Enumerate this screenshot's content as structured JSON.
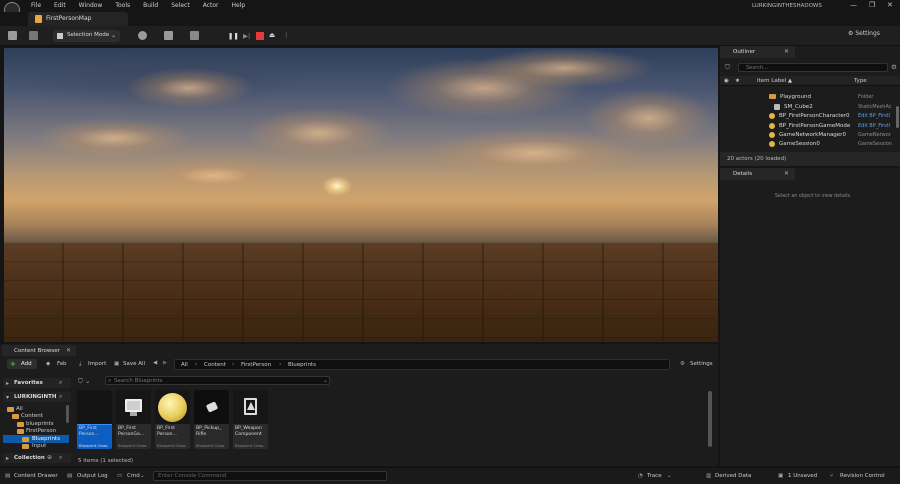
{
  "menubar": {
    "items": [
      "File",
      "Edit",
      "Window",
      "Tools",
      "Build",
      "Select",
      "Actor",
      "Help"
    ],
    "project": "LURKINGINTHESHADOWS",
    "window_controls": [
      "minimize-icon",
      "restore-icon",
      "close-icon"
    ]
  },
  "tab": {
    "title": "FirstPersonMap"
  },
  "toolbar": {
    "selection_mode": "Selection Mode",
    "settings": "Settings"
  },
  "outliner": {
    "tab": "Outliner",
    "search_placeholder": "Search...",
    "col_label": "Item Label ▲",
    "col_type": "Type",
    "rows": [
      {
        "label": "Playground",
        "type": "Folder",
        "link": false,
        "icon": "folder-icon"
      },
      {
        "label": "SM_Cube2",
        "type": "StaticMeshAc",
        "link": false,
        "icon": "mesh-icon"
      },
      {
        "label": "BP_FirstPersonCharacter0",
        "type": "Edit BP_FirstI",
        "link": true,
        "icon": "actor-icon"
      },
      {
        "label": "BP_FirstPersonGameMode",
        "type": "Edit BP_FirstI",
        "link": true,
        "icon": "actor-icon"
      },
      {
        "label": "GameNetworkManager0",
        "type": "GameNetwor",
        "link": false,
        "icon": "actor-icon"
      },
      {
        "label": "GameSession0",
        "type": "GameSession",
        "link": false,
        "icon": "actor-icon"
      }
    ],
    "footer": "20 actors (20 loaded)"
  },
  "details": {
    "tab": "Details",
    "message": "Select an object to view details."
  },
  "content_browser": {
    "tab": "Content Browser",
    "add": "Add",
    "fab": "Fab",
    "import": "Import",
    "save_all": "Save All",
    "breadcrumbs": [
      "All",
      "Content",
      "FirstPerson",
      "Blueprints"
    ],
    "settings": "Settings",
    "favorites": "Favorites",
    "project_root": "LURKINGINTH",
    "tree": [
      {
        "label": "All",
        "indent": 0,
        "selected": false
      },
      {
        "label": "Content",
        "indent": 1,
        "selected": false
      },
      {
        "label": "blueprints",
        "indent": 2,
        "selected": false
      },
      {
        "label": "FirstPerson",
        "indent": 2,
        "selected": false
      },
      {
        "label": "Blueprints",
        "indent": 3,
        "selected": true
      },
      {
        "label": "Input",
        "indent": 3,
        "selected": false
      }
    ],
    "collections": "Collection",
    "search_placeholder": "Search Blueprints",
    "assets": [
      {
        "name": "BP_First\nPerson...",
        "class": "Blueprint Class",
        "selected": true,
        "thumb": "dark"
      },
      {
        "name": "BP_First\nPersonGa...",
        "class": "Blueprint Class",
        "selected": false,
        "thumb": "monitor"
      },
      {
        "name": "BP_First\nPerson...",
        "class": "Blueprint Class",
        "selected": false,
        "thumb": "sphere"
      },
      {
        "name": "BP_Pickup_\nRifle",
        "class": "Blueprint Class",
        "selected": false,
        "thumb": "rifle"
      },
      {
        "name": "BP_Weapon\nComponent",
        "class": "Blueprint Class",
        "selected": false,
        "thumb": "component"
      }
    ],
    "count": "5 items (1 selected)"
  },
  "statusbar": {
    "content_drawer": "Content Drawer",
    "output_log": "Output Log",
    "cmd": "Cmd",
    "console_placeholder": "Enter Console Command",
    "trace": "Trace",
    "derived_data": "Derived Data",
    "unsaved": "1 Unsaved",
    "revision": "Revision Control"
  },
  "colors": {
    "accent_blue": "#0d5ec2",
    "add_green": "#4ec44e",
    "folder": "#d79a3d",
    "stop_red": "#e03a3a"
  }
}
